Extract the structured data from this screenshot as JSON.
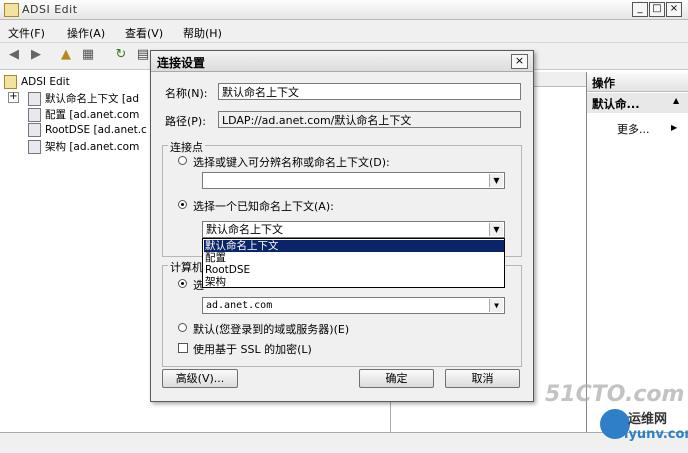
{
  "window": {
    "title": "ADSI Edit"
  },
  "caption_buttons": {
    "minimize": "_",
    "maximize": "□",
    "close": "×"
  },
  "menu": [
    "文件(F)",
    "操作(A)",
    "查看(V)",
    "帮助(H)"
  ],
  "tree": {
    "root": "ADSI Edit",
    "items": [
      {
        "label": "默认命名上下文 [ad"
      },
      {
        "label": "配置 [ad.anet.com"
      },
      {
        "label": "RootDSE [ad.anet.c"
      },
      {
        "label": "架构 [ad.anet.com"
      }
    ],
    "expander": "+"
  },
  "actions_pane": {
    "header": "操作",
    "subheader": "默认命...",
    "more": "更多...",
    "collapse_arrow": "▲",
    "more_arrow": "▶"
  },
  "dialog": {
    "title": "连接设置",
    "close": "×",
    "name_label": "名称(N):",
    "name_value": "默认命名上下文",
    "path_label": "路径(P):",
    "path_value": "LDAP://ad.anet.com/默认命名上下文",
    "connection_point": {
      "group_title": "连接点",
      "option1": "选择或键入可分辨名称或命名上下文(D):",
      "option1_value": "",
      "option2": "选择一个已知命名上下文(A):",
      "option2_value": "默认命名上下文",
      "dropdown_options": [
        "默认命名上下文",
        "配置",
        "RootDSE",
        "架构"
      ],
      "selected_index": 0
    },
    "computer": {
      "group_title": "计算机",
      "option1": "选",
      "option1_tail": "构",
      "option1_value": "ad.anet.com",
      "option2": "默认(您登录到的域或服务器)(E)",
      "ssl_label": "使用基于 SSL 的加密(L)"
    },
    "buttons": {
      "advanced": "高级(V)...",
      "ok": "确定",
      "cancel": "取消"
    }
  },
  "watermark": {
    "text1": "51CTO.com",
    "text2": "运维网",
    "text3": "iyunv.com"
  }
}
